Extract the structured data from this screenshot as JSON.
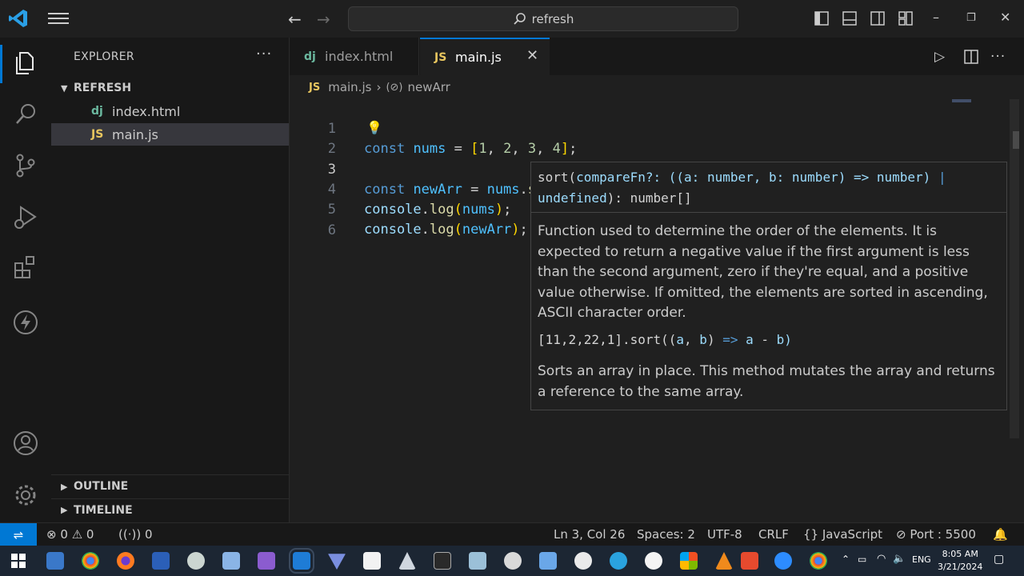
{
  "titlebar": {
    "search_text": "refresh",
    "icons": [
      "vscode-logo-icon",
      "menu-icon",
      "back-arrow-icon",
      "forward-arrow-icon",
      "search-icon",
      "toggle-sidebar-icon",
      "toggle-panel-icon",
      "toggle-secondary-sidebar-icon",
      "customize-layout-icon",
      "minimize-icon",
      "restore-icon",
      "close-icon"
    ]
  },
  "activitybar": {
    "items": [
      "explorer-icon",
      "search-icon",
      "source-control-icon",
      "run-debug-icon",
      "extensions-icon",
      "lightning-icon"
    ],
    "bottom": [
      "account-icon",
      "settings-gear-icon"
    ]
  },
  "sidebar": {
    "title": "EXPLORER",
    "more": "···",
    "folder": "REFRESH",
    "files": [
      {
        "badge": "dj",
        "name": "index.html",
        "color": "#6bb89f"
      },
      {
        "badge": "JS",
        "name": "main.js",
        "color": "#e8c65f"
      }
    ],
    "outline": "OUTLINE",
    "timeline": "TIMELINE"
  },
  "tabs": [
    {
      "badge": "dj",
      "label": "index.html"
    },
    {
      "badge": "JS",
      "label": "main.js",
      "close": "✕"
    }
  ],
  "breadcrumb": {
    "file": "main.js",
    "symbol": "newArr"
  },
  "code": {
    "line_numbers": [
      "1",
      "2",
      "3",
      "4",
      "5",
      "6"
    ],
    "line1": {
      "kw": "const",
      "var": "nums",
      "eq": " = ",
      "open": "[",
      "n1": "1",
      "n2": "2",
      "n3": "3",
      "n4": "4",
      "close": "]",
      "semi": ";"
    },
    "line3": {
      "kw": "const",
      "var": "newArr",
      "eq": " = ",
      "obj": "nums",
      "dot": ".",
      "fn": "sort",
      "open": "(",
      "close": ")"
    },
    "line4": {
      "obj": "console",
      "dot": ".",
      "fn": "log",
      "open": "(",
      "arg": "nums",
      "close": ")",
      "semi": ";"
    },
    "line5": {
      "obj": "console",
      "dot": ".",
      "fn": "log",
      "open": "(",
      "arg": "newArr",
      "close": ")",
      "semi": ";"
    }
  },
  "hover": {
    "sig_fn": "sort(",
    "sig_param": "compareFn?",
    "sig_colon": ": ((",
    "sig_a": "a",
    "sig_a_type": ": number, ",
    "sig_b": "b",
    "sig_b_type": ": number) ",
    "sig_arrow": "=>",
    "sig_ret": " number) ",
    "sig_pipe": "|",
    "sig_undefined": "undefined",
    "sig_end": "): number[]",
    "doc": "Function used to determine the order of the elements. It is expected to return a negative value if the first argument is less than the second argument, zero if they're equal, and a positive value otherwise. If omitted, the elements are sorted in ascending, ASCII character order.",
    "ex_start": "[11,2,22,1].sort((",
    "ex_a": "a",
    "ex_comma": ", ",
    "ex_b": "b",
    "ex_paren": ") ",
    "ex_arrow": "=>",
    "ex_body_a": " a ",
    "ex_minus": "-",
    "ex_body_b": " b)",
    "note": "Sorts an array in place. This method mutates the array and returns a reference to the same array."
  },
  "statusbar": {
    "errors": "0",
    "warnings": "0",
    "ports": "0",
    "position": "Ln 3, Col 26",
    "spaces": "Spaces: 2",
    "encoding": "UTF-8",
    "eol": "CRLF",
    "language": "JavaScript",
    "port": "Port : 5500"
  },
  "taskbar": {
    "lang": "ENG",
    "time": "8:05 AM",
    "date": "3/21/2024"
  },
  "colors": {
    "accent": "#0078d4",
    "keyword": "#569cd6",
    "variable": "#4fc1ff",
    "function": "#dcdcaa",
    "number": "#b5cea8"
  }
}
